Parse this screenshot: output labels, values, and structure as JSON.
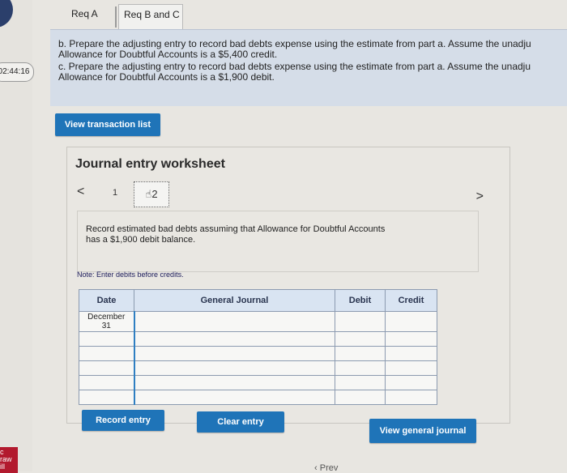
{
  "sidebar": {
    "timer": "02:44:16",
    "brand_lines": [
      "c",
      "raw",
      "ill"
    ]
  },
  "tabs": [
    {
      "label": "Req A"
    },
    {
      "label": "Req B and C"
    }
  ],
  "question": {
    "part_b": "b. Prepare the adjusting entry to record bad debts expense using the estimate from part a. Assume the unadju Allowance for Doubtful Accounts is a $5,400 credit.",
    "part_b_line1": "b. Prepare the adjusting entry to record bad debts expense using the estimate from part a. Assume the unadju",
    "part_b_line2": "Allowance for Doubtful Accounts is a $5,400 credit.",
    "part_c_line1": "c. Prepare the adjusting entry to record bad debts expense using the estimate from part a. Assume the unadju",
    "part_c_line2": "Allowance for Doubtful Accounts is a $1,900 debit."
  },
  "buttons": {
    "view_transactions": "View transaction list",
    "record_entry": "Record entry",
    "clear_entry": "Clear entry",
    "view_general_journal": "View general journal"
  },
  "worksheet": {
    "title": "Journal entry worksheet",
    "prev": "<",
    "next": ">",
    "entry_number": "1",
    "current_entry_icon": "hand-pointer-icon",
    "current_entry_number": "2",
    "instruction_line1": "Record estimated bad debts assuming that Allowance for Doubtful Accounts",
    "instruction_line2": "has a $1,900 debit balance.",
    "note": "Note: Enter debits before credits."
  },
  "journal_table": {
    "headers": {
      "date": "Date",
      "account": "General Journal",
      "debit": "Debit",
      "credit": "Credit"
    },
    "rows": [
      {
        "date_line1": "December",
        "date_line2": "31",
        "account": "",
        "debit": "",
        "credit": ""
      },
      {
        "date_line1": "",
        "date_line2": "",
        "account": "",
        "debit": "",
        "credit": ""
      },
      {
        "date_line1": "",
        "date_line2": "",
        "account": "",
        "debit": "",
        "credit": ""
      },
      {
        "date_line1": "",
        "date_line2": "",
        "account": "",
        "debit": "",
        "credit": ""
      },
      {
        "date_line1": "",
        "date_line2": "",
        "account": "",
        "debit": "",
        "credit": ""
      },
      {
        "date_line1": "",
        "date_line2": "",
        "account": "",
        "debit": "",
        "credit": ""
      }
    ]
  },
  "footer": {
    "prev_label": "Prev"
  },
  "colors": {
    "accent": "#1f74b8",
    "question_bg": "#d5dde8",
    "header_bg": "#d9e4f2"
  }
}
